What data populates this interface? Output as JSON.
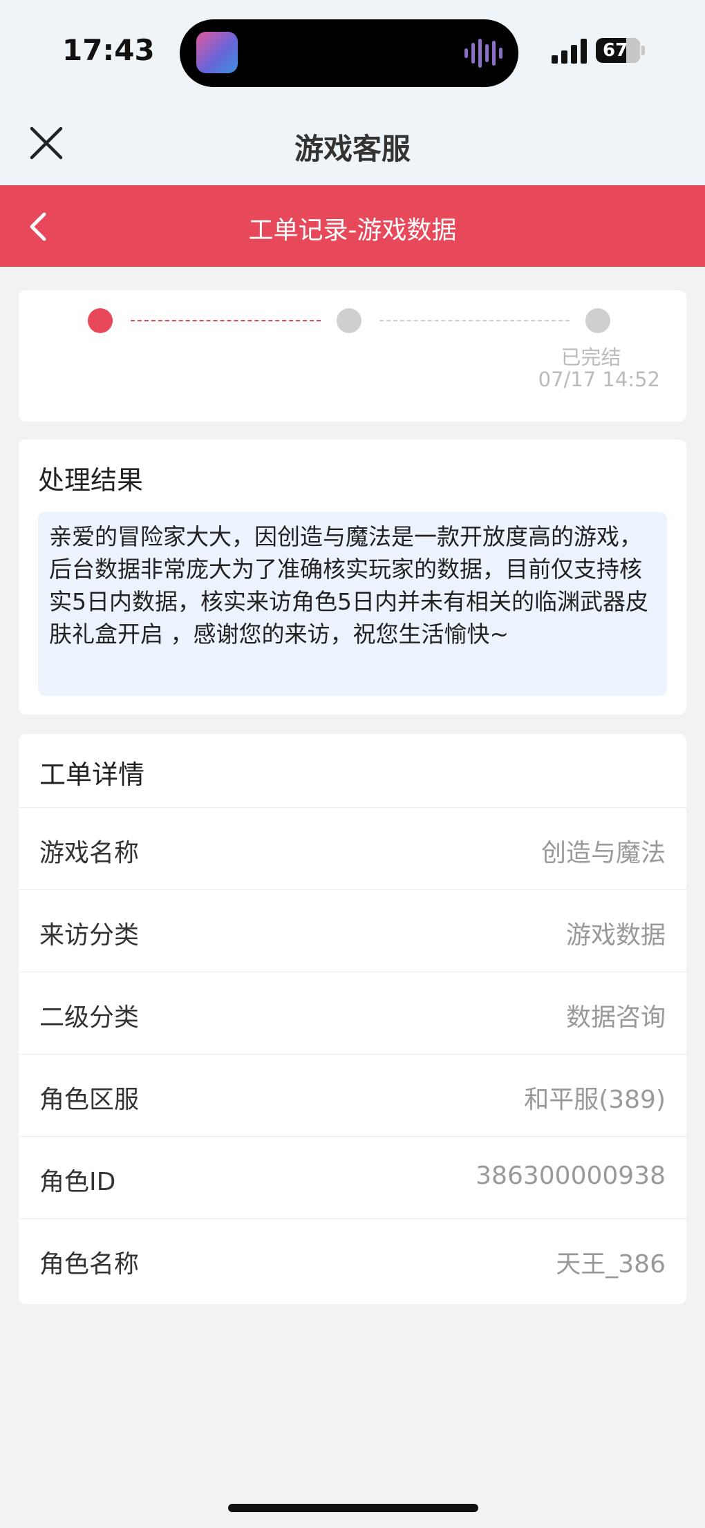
{
  "status": {
    "time": "17:43",
    "battery": "67"
  },
  "header": {
    "title": "游戏客服",
    "subtitle": "工单记录-游戏数据"
  },
  "progress": {
    "status": "已完结",
    "time": "07/17 14:52"
  },
  "result": {
    "title": "处理结果",
    "text": "亲爱的冒险家大大，因创造与魔法是一款开放度高的游戏，后台数据非常庞大为了准确核实玩家的数据，目前仅支持核实5日内数据，核实来访角色5日内并未有相关的临渊武器皮肤礼盒开启 ，感谢您的来访，祝您生活愉快~"
  },
  "details": {
    "title": "工单详情",
    "rows": [
      {
        "label": "游戏名称",
        "value": "创造与魔法"
      },
      {
        "label": "来访分类",
        "value": "游戏数据"
      },
      {
        "label": "二级分类",
        "value": "数据咨询"
      },
      {
        "label": "角色区服",
        "value": "和平服(389)"
      },
      {
        "label": "角色ID",
        "value": "386300000938"
      },
      {
        "label": "角色名称",
        "value": "天王_386"
      }
    ]
  }
}
